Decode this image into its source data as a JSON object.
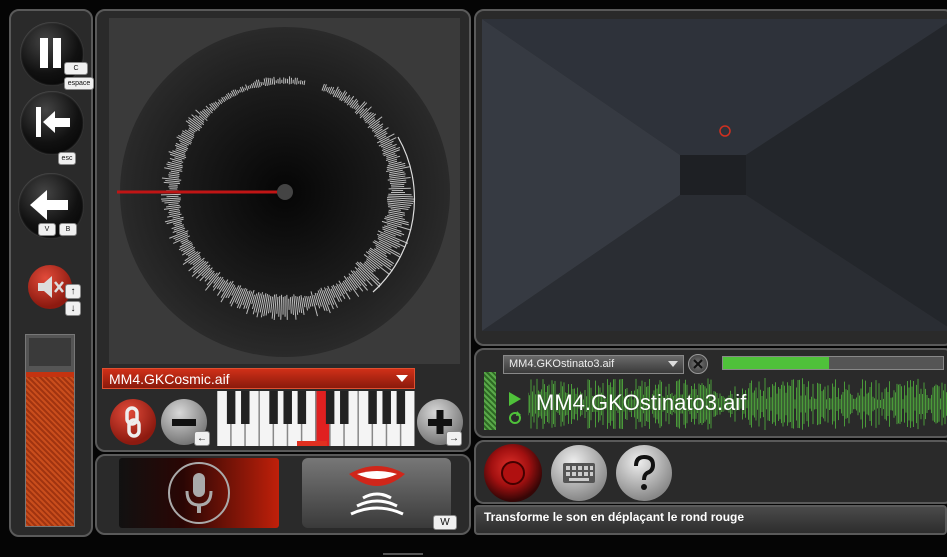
{
  "controls": {
    "pause_key_c": "C",
    "pause_key_space": "espace",
    "rewind_key": "esc",
    "back_key_v": "V",
    "back_key_b": "B",
    "mute_key_up": "↑",
    "mute_key_down": "↓"
  },
  "turntable": {
    "file_name": "MM4.GKCosmic.aif",
    "minus_key": "←",
    "plus_key": "→"
  },
  "voice": {
    "mouth_key": "W"
  },
  "track": {
    "dropdown_value": "MM4.GKOstinato3.aif",
    "waveform_title": "MM4.GKOstinato3.aif",
    "progress": 0.48
  },
  "status": {
    "hint": "Transforme le son en déplaçant le rond rouge"
  },
  "colors": {
    "accent_red": "#d12a10",
    "green": "#4fc13a",
    "panel": "#2a2a2a"
  }
}
